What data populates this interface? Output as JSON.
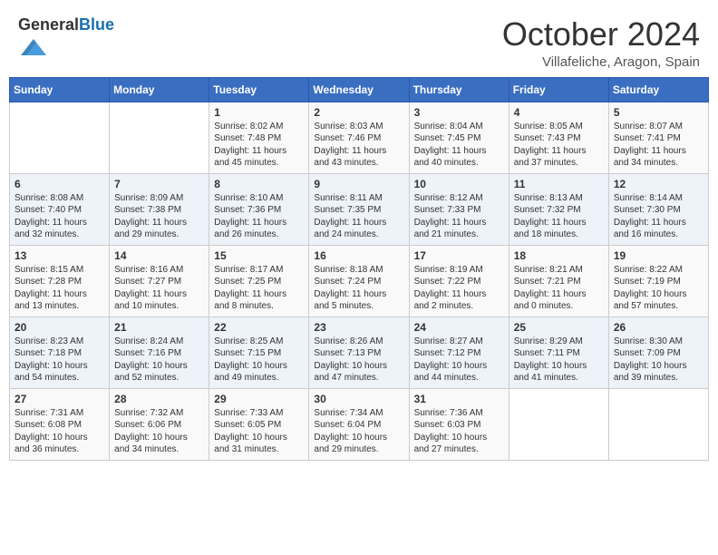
{
  "header": {
    "logo_general": "General",
    "logo_blue": "Blue",
    "month_title": "October 2024",
    "subtitle": "Villafeliche, Aragon, Spain"
  },
  "days_of_week": [
    "Sunday",
    "Monday",
    "Tuesday",
    "Wednesday",
    "Thursday",
    "Friday",
    "Saturday"
  ],
  "weeks": [
    [
      {
        "day": "",
        "sunrise": "",
        "sunset": "",
        "daylight": ""
      },
      {
        "day": "",
        "sunrise": "",
        "sunset": "",
        "daylight": ""
      },
      {
        "day": "1",
        "sunrise": "Sunrise: 8:02 AM",
        "sunset": "Sunset: 7:48 PM",
        "daylight": "Daylight: 11 hours and 45 minutes."
      },
      {
        "day": "2",
        "sunrise": "Sunrise: 8:03 AM",
        "sunset": "Sunset: 7:46 PM",
        "daylight": "Daylight: 11 hours and 43 minutes."
      },
      {
        "day": "3",
        "sunrise": "Sunrise: 8:04 AM",
        "sunset": "Sunset: 7:45 PM",
        "daylight": "Daylight: 11 hours and 40 minutes."
      },
      {
        "day": "4",
        "sunrise": "Sunrise: 8:05 AM",
        "sunset": "Sunset: 7:43 PM",
        "daylight": "Daylight: 11 hours and 37 minutes."
      },
      {
        "day": "5",
        "sunrise": "Sunrise: 8:07 AM",
        "sunset": "Sunset: 7:41 PM",
        "daylight": "Daylight: 11 hours and 34 minutes."
      }
    ],
    [
      {
        "day": "6",
        "sunrise": "Sunrise: 8:08 AM",
        "sunset": "Sunset: 7:40 PM",
        "daylight": "Daylight: 11 hours and 32 minutes."
      },
      {
        "day": "7",
        "sunrise": "Sunrise: 8:09 AM",
        "sunset": "Sunset: 7:38 PM",
        "daylight": "Daylight: 11 hours and 29 minutes."
      },
      {
        "day": "8",
        "sunrise": "Sunrise: 8:10 AM",
        "sunset": "Sunset: 7:36 PM",
        "daylight": "Daylight: 11 hours and 26 minutes."
      },
      {
        "day": "9",
        "sunrise": "Sunrise: 8:11 AM",
        "sunset": "Sunset: 7:35 PM",
        "daylight": "Daylight: 11 hours and 24 minutes."
      },
      {
        "day": "10",
        "sunrise": "Sunrise: 8:12 AM",
        "sunset": "Sunset: 7:33 PM",
        "daylight": "Daylight: 11 hours and 21 minutes."
      },
      {
        "day": "11",
        "sunrise": "Sunrise: 8:13 AM",
        "sunset": "Sunset: 7:32 PM",
        "daylight": "Daylight: 11 hours and 18 minutes."
      },
      {
        "day": "12",
        "sunrise": "Sunrise: 8:14 AM",
        "sunset": "Sunset: 7:30 PM",
        "daylight": "Daylight: 11 hours and 16 minutes."
      }
    ],
    [
      {
        "day": "13",
        "sunrise": "Sunrise: 8:15 AM",
        "sunset": "Sunset: 7:28 PM",
        "daylight": "Daylight: 11 hours and 13 minutes."
      },
      {
        "day": "14",
        "sunrise": "Sunrise: 8:16 AM",
        "sunset": "Sunset: 7:27 PM",
        "daylight": "Daylight: 11 hours and 10 minutes."
      },
      {
        "day": "15",
        "sunrise": "Sunrise: 8:17 AM",
        "sunset": "Sunset: 7:25 PM",
        "daylight": "Daylight: 11 hours and 8 minutes."
      },
      {
        "day": "16",
        "sunrise": "Sunrise: 8:18 AM",
        "sunset": "Sunset: 7:24 PM",
        "daylight": "Daylight: 11 hours and 5 minutes."
      },
      {
        "day": "17",
        "sunrise": "Sunrise: 8:19 AM",
        "sunset": "Sunset: 7:22 PM",
        "daylight": "Daylight: 11 hours and 2 minutes."
      },
      {
        "day": "18",
        "sunrise": "Sunrise: 8:21 AM",
        "sunset": "Sunset: 7:21 PM",
        "daylight": "Daylight: 11 hours and 0 minutes."
      },
      {
        "day": "19",
        "sunrise": "Sunrise: 8:22 AM",
        "sunset": "Sunset: 7:19 PM",
        "daylight": "Daylight: 10 hours and 57 minutes."
      }
    ],
    [
      {
        "day": "20",
        "sunrise": "Sunrise: 8:23 AM",
        "sunset": "Sunset: 7:18 PM",
        "daylight": "Daylight: 10 hours and 54 minutes."
      },
      {
        "day": "21",
        "sunrise": "Sunrise: 8:24 AM",
        "sunset": "Sunset: 7:16 PM",
        "daylight": "Daylight: 10 hours and 52 minutes."
      },
      {
        "day": "22",
        "sunrise": "Sunrise: 8:25 AM",
        "sunset": "Sunset: 7:15 PM",
        "daylight": "Daylight: 10 hours and 49 minutes."
      },
      {
        "day": "23",
        "sunrise": "Sunrise: 8:26 AM",
        "sunset": "Sunset: 7:13 PM",
        "daylight": "Daylight: 10 hours and 47 minutes."
      },
      {
        "day": "24",
        "sunrise": "Sunrise: 8:27 AM",
        "sunset": "Sunset: 7:12 PM",
        "daylight": "Daylight: 10 hours and 44 minutes."
      },
      {
        "day": "25",
        "sunrise": "Sunrise: 8:29 AM",
        "sunset": "Sunset: 7:11 PM",
        "daylight": "Daylight: 10 hours and 41 minutes."
      },
      {
        "day": "26",
        "sunrise": "Sunrise: 8:30 AM",
        "sunset": "Sunset: 7:09 PM",
        "daylight": "Daylight: 10 hours and 39 minutes."
      }
    ],
    [
      {
        "day": "27",
        "sunrise": "Sunrise: 7:31 AM",
        "sunset": "Sunset: 6:08 PM",
        "daylight": "Daylight: 10 hours and 36 minutes."
      },
      {
        "day": "28",
        "sunrise": "Sunrise: 7:32 AM",
        "sunset": "Sunset: 6:06 PM",
        "daylight": "Daylight: 10 hours and 34 minutes."
      },
      {
        "day": "29",
        "sunrise": "Sunrise: 7:33 AM",
        "sunset": "Sunset: 6:05 PM",
        "daylight": "Daylight: 10 hours and 31 minutes."
      },
      {
        "day": "30",
        "sunrise": "Sunrise: 7:34 AM",
        "sunset": "Sunset: 6:04 PM",
        "daylight": "Daylight: 10 hours and 29 minutes."
      },
      {
        "day": "31",
        "sunrise": "Sunrise: 7:36 AM",
        "sunset": "Sunset: 6:03 PM",
        "daylight": "Daylight: 10 hours and 27 minutes."
      },
      {
        "day": "",
        "sunrise": "",
        "sunset": "",
        "daylight": ""
      },
      {
        "day": "",
        "sunrise": "",
        "sunset": "",
        "daylight": ""
      }
    ]
  ]
}
